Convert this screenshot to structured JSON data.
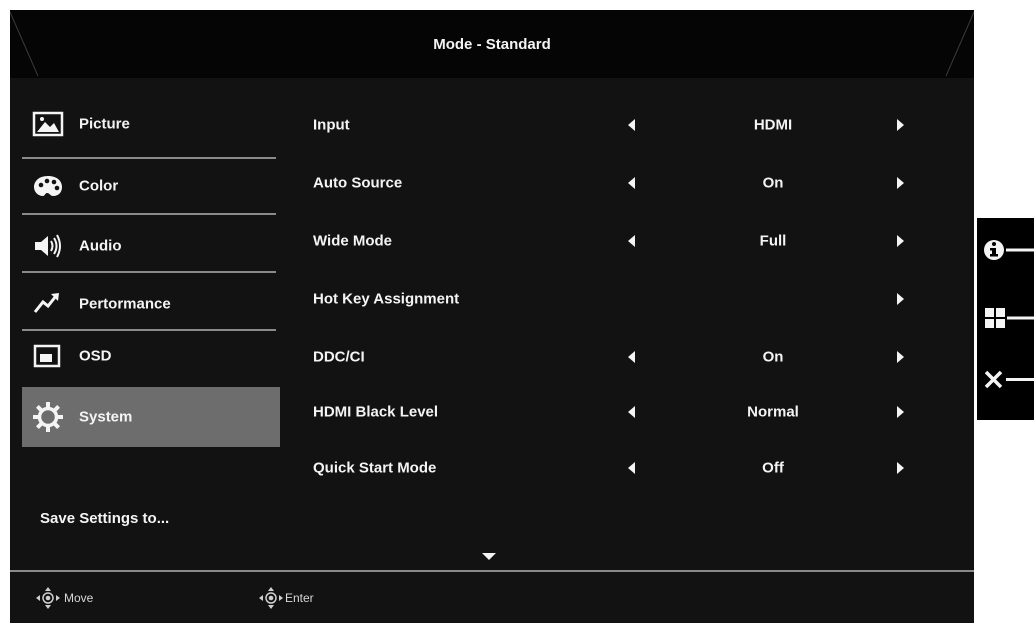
{
  "header": {
    "title": "Mode - Standard"
  },
  "sidebar": {
    "items": [
      {
        "label": "Picture",
        "icon": "picture-icon"
      },
      {
        "label": "Color",
        "icon": "palette-icon"
      },
      {
        "label": "Audio",
        "icon": "speaker-icon"
      },
      {
        "label": "Pertormance",
        "icon": "performance-icon"
      },
      {
        "label": "OSD",
        "icon": "osd-icon"
      },
      {
        "label": "System",
        "icon": "gear-icon",
        "active": true
      }
    ],
    "save_label": "Save Settings to..."
  },
  "settings": {
    "rows": [
      {
        "name": "Input",
        "value": "HDMI"
      },
      {
        "name": "Auto Source",
        "value": "On"
      },
      {
        "name": "Wide Mode",
        "value": "Full"
      },
      {
        "name": "Hot Key Assignment",
        "value": ""
      },
      {
        "name": "DDC/CI",
        "value": "On"
      },
      {
        "name": "HDMI Black Level",
        "value": "Normal"
      },
      {
        "name": "Quick Start Mode",
        "value": "Off"
      }
    ]
  },
  "footer": {
    "move_label": "Move",
    "enter_label": "Enter"
  },
  "hotkeys": [
    "info-icon",
    "grid-icon",
    "close-icon"
  ],
  "colors": {
    "panel": "#121212",
    "header": "#050505",
    "active_item": "#6d6d6d",
    "separator": "#8a8a8a",
    "text": "#f4f4f4"
  }
}
